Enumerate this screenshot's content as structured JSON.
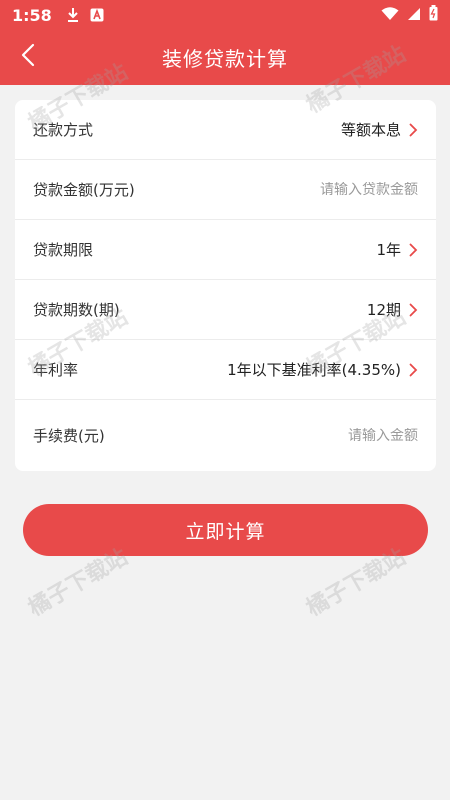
{
  "status_bar": {
    "time": "1:58",
    "icons_left": [
      "download-icon",
      "app-notification-icon"
    ],
    "icons_right": [
      "wifi-icon",
      "signal-icon",
      "battery-icon"
    ]
  },
  "header": {
    "title": "装修贷款计算",
    "back_icon": "chevron-left-icon"
  },
  "form": {
    "repay_method": {
      "label": "还款方式",
      "value": "等额本息"
    },
    "loan_amount": {
      "label": "贷款金额(万元)",
      "placeholder": "请输入贷款金额",
      "value": ""
    },
    "loan_term": {
      "label": "贷款期限",
      "value": "1年"
    },
    "loan_periods": {
      "label": "贷款期数(期)",
      "value": "12期"
    },
    "annual_rate": {
      "label": "年利率",
      "value": "1年以下基准利率(4.35%)"
    },
    "fee": {
      "label": "手续费(元)",
      "placeholder": "请输入金额",
      "value": ""
    }
  },
  "actions": {
    "calculate_label": "立即计算"
  },
  "watermark": "橘子下载站",
  "colors": {
    "accent": "#e84a4a",
    "background": "#f2f2f2"
  }
}
